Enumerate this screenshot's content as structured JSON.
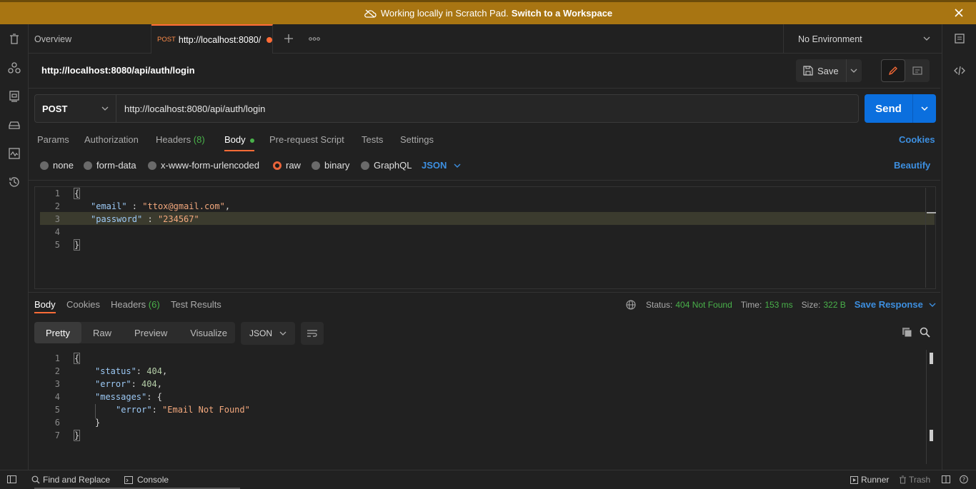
{
  "banner": {
    "text": "Working locally in Scratch Pad.",
    "link": "Switch to a Workspace"
  },
  "tabs": {
    "overview": "Overview",
    "request_method": "POST",
    "request_title": "http://localhost:8080/",
    "environment": "No Environment"
  },
  "request": {
    "title": "http://localhost:8080/api/auth/login",
    "save_label": "Save",
    "method": "POST",
    "url": "http://localhost:8080/api/auth/login",
    "send_label": "Send"
  },
  "req_tabs": {
    "params": "Params",
    "authorization": "Authorization",
    "headers": "Headers",
    "headers_count": "(8)",
    "body": "Body",
    "prerequest": "Pre-request Script",
    "tests": "Tests",
    "settings": "Settings",
    "cookies": "Cookies"
  },
  "body_types": {
    "none": "none",
    "form_data": "form-data",
    "urlencoded": "x-www-form-urlencoded",
    "raw": "raw",
    "binary": "binary",
    "graphql": "GraphQL",
    "json": "JSON",
    "beautify": "Beautify"
  },
  "req_body": {
    "line_numbers": [
      "1",
      "2",
      "3",
      "4",
      "5"
    ],
    "open": "{",
    "email_key": "\"email\"",
    "email_val": "\"ttox@gmail.com\"",
    "password_key": "\"password\"",
    "password_val": "\"234567\"",
    "close": "}"
  },
  "response": {
    "tabs": {
      "body": "Body",
      "cookies": "Cookies",
      "headers": "Headers",
      "headers_count": "(6)",
      "test_results": "Test Results"
    },
    "status_label": "Status:",
    "status_value": "404 Not Found",
    "time_label": "Time:",
    "time_value": "153 ms",
    "size_label": "Size:",
    "size_value": "322 B",
    "save_response": "Save Response",
    "formats": {
      "pretty": "Pretty",
      "raw": "Raw",
      "preview": "Preview",
      "visualize": "Visualize"
    },
    "format_json": "JSON",
    "line_numbers": [
      "1",
      "2",
      "3",
      "4",
      "5",
      "6",
      "7"
    ],
    "open": "{",
    "status_key": "\"status\"",
    "status_num": "404",
    "error_key": "\"error\"",
    "error_num": "404",
    "messages_key": "\"messages\"",
    "inner_open": "{",
    "inner_error_key": "\"error\"",
    "inner_error_val": "\"Email Not Found\"",
    "inner_close": "}",
    "close": "}"
  },
  "footer": {
    "find_replace": "Find and Replace",
    "console": "Console",
    "runner": "Runner",
    "trash": "Trash"
  }
}
